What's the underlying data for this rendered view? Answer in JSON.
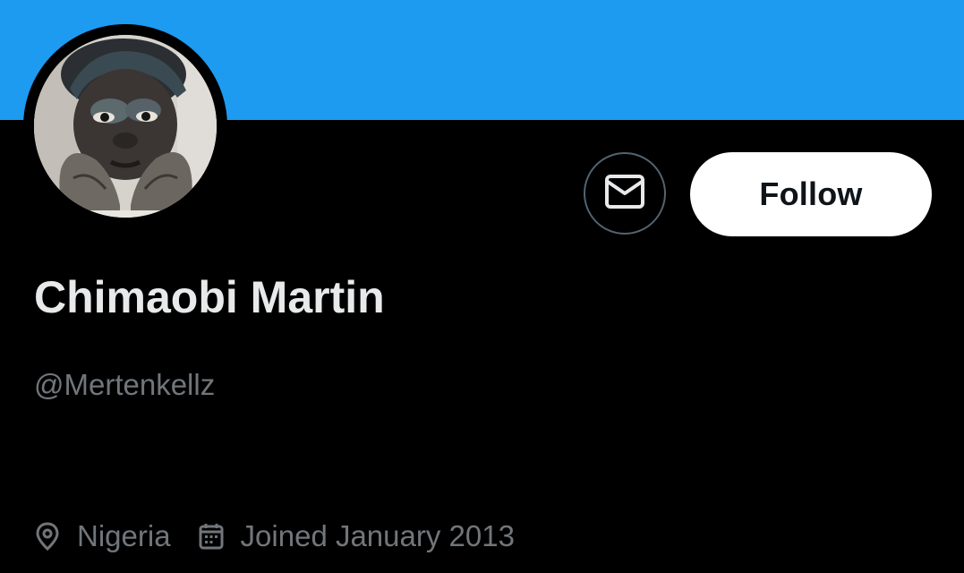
{
  "profile": {
    "display_name": "Chimaobi Martin",
    "handle": "@Mertenkellz",
    "location": "Nigeria",
    "joined": "Joined January 2013"
  },
  "actions": {
    "message_icon": "envelope-icon",
    "follow_label": "Follow"
  },
  "icons": {
    "location": "location-pin-icon",
    "joined": "calendar-icon"
  },
  "colors": {
    "banner": "#1d9bf0",
    "background": "#000000",
    "primary_text": "#e7e9ea",
    "secondary_text": "#71767b",
    "follow_button_bg": "#ffffff",
    "follow_button_text": "#0f1419",
    "outline": "#536471"
  }
}
